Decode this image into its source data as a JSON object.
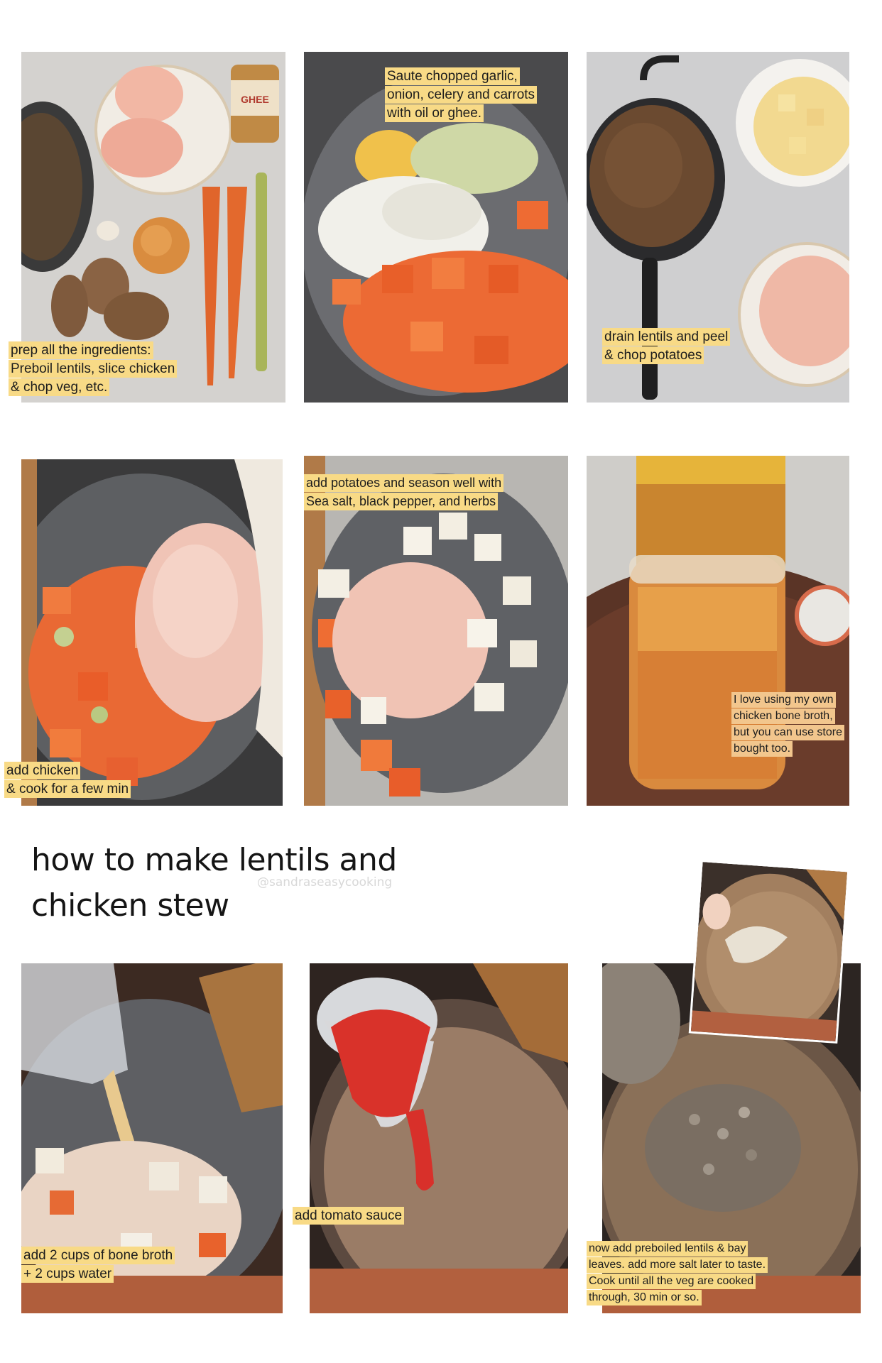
{
  "title": {
    "line1": "how to make lentils and",
    "line2": "chicken stew"
  },
  "watermark": "@sandraseasycooking",
  "steps": [
    {
      "lines": [
        "prep all the ingredients:",
        "Preboil lentils, slice chicken",
        "& chop veg, etc."
      ]
    },
    {
      "lines": [
        "Saute chopped garlic,",
        "onion, celery and carrots",
        "with oil or ghee."
      ]
    },
    {
      "lines": [
        "drain lentils and peel",
        "& chop potatoes"
      ]
    },
    {
      "lines": [
        "add chicken",
        "& cook for a few min"
      ]
    },
    {
      "lines": [
        "add potatoes and season well with",
        "Sea salt, black pepper, and herbs"
      ]
    },
    {
      "lines": [
        "I love using my own",
        "chicken bone broth,",
        "but you can use store",
        "bought too."
      ]
    },
    {
      "lines": [
        "add  2 cups of bone broth",
        "+ 2 cups water"
      ]
    },
    {
      "lines": [
        "add tomato sauce"
      ]
    },
    {
      "lines": [
        "now add preboiled lentils & bay",
        "leaves. add more salt later to taste.",
        "Cook until all the veg are cooked",
        "through, 30 min or so."
      ]
    }
  ],
  "jar_label": "GHEE"
}
